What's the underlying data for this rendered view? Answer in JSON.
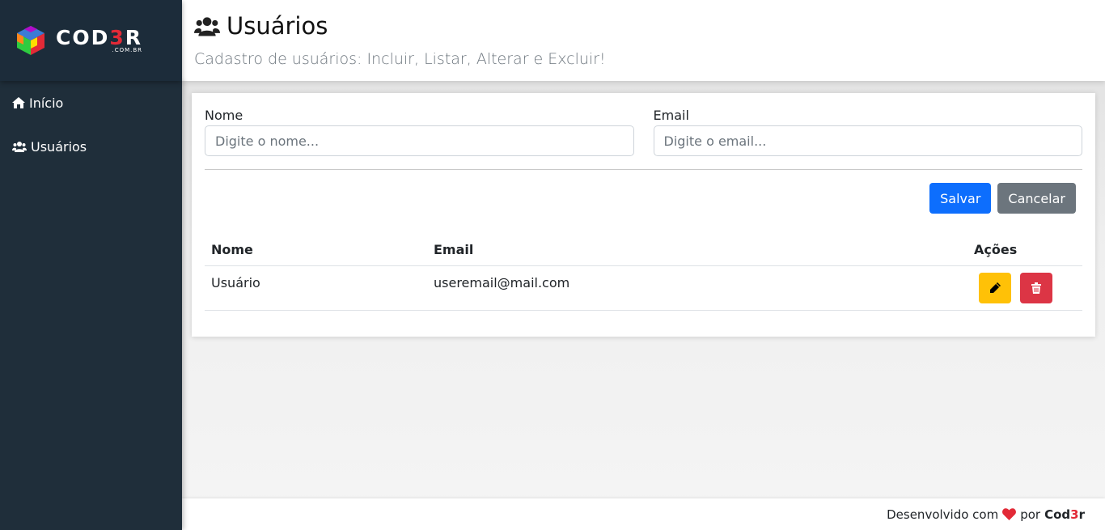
{
  "logo": {
    "word_prefix": "COD",
    "word_three": "3",
    "word_suffix": "R",
    "sub": ".COM.BR"
  },
  "menu": {
    "items": [
      {
        "label": "Início",
        "icon": "home-icon"
      },
      {
        "label": "Usuários",
        "icon": "users-icon"
      }
    ]
  },
  "header": {
    "icon": "users-icon",
    "title": "Usuários",
    "subtitle": "Cadastro de usuários: Incluir, Listar, Alterar e Excluir!"
  },
  "form": {
    "name_label": "Nome",
    "name_placeholder": "Digite o nome...",
    "name_value": "",
    "email_label": "Email",
    "email_placeholder": "Digite o email...",
    "email_value": "",
    "save_label": "Salvar",
    "cancel_label": "Cancelar"
  },
  "table": {
    "columns": [
      "Nome",
      "Email",
      "Ações"
    ],
    "rows": [
      {
        "name": "Usuário",
        "email": "useremail@mail.com"
      }
    ]
  },
  "footer": {
    "text": "Desenvolvido com",
    "by": "por",
    "brand_prefix": "Cod",
    "brand_three": "3",
    "brand_suffix": "r"
  },
  "colors": {
    "sidebar": "#1f2e3a",
    "primary": "#0d6efd",
    "secondary": "#6c757d",
    "warning": "#ffc107",
    "danger": "#dc3545",
    "heart": "#e22a37"
  }
}
